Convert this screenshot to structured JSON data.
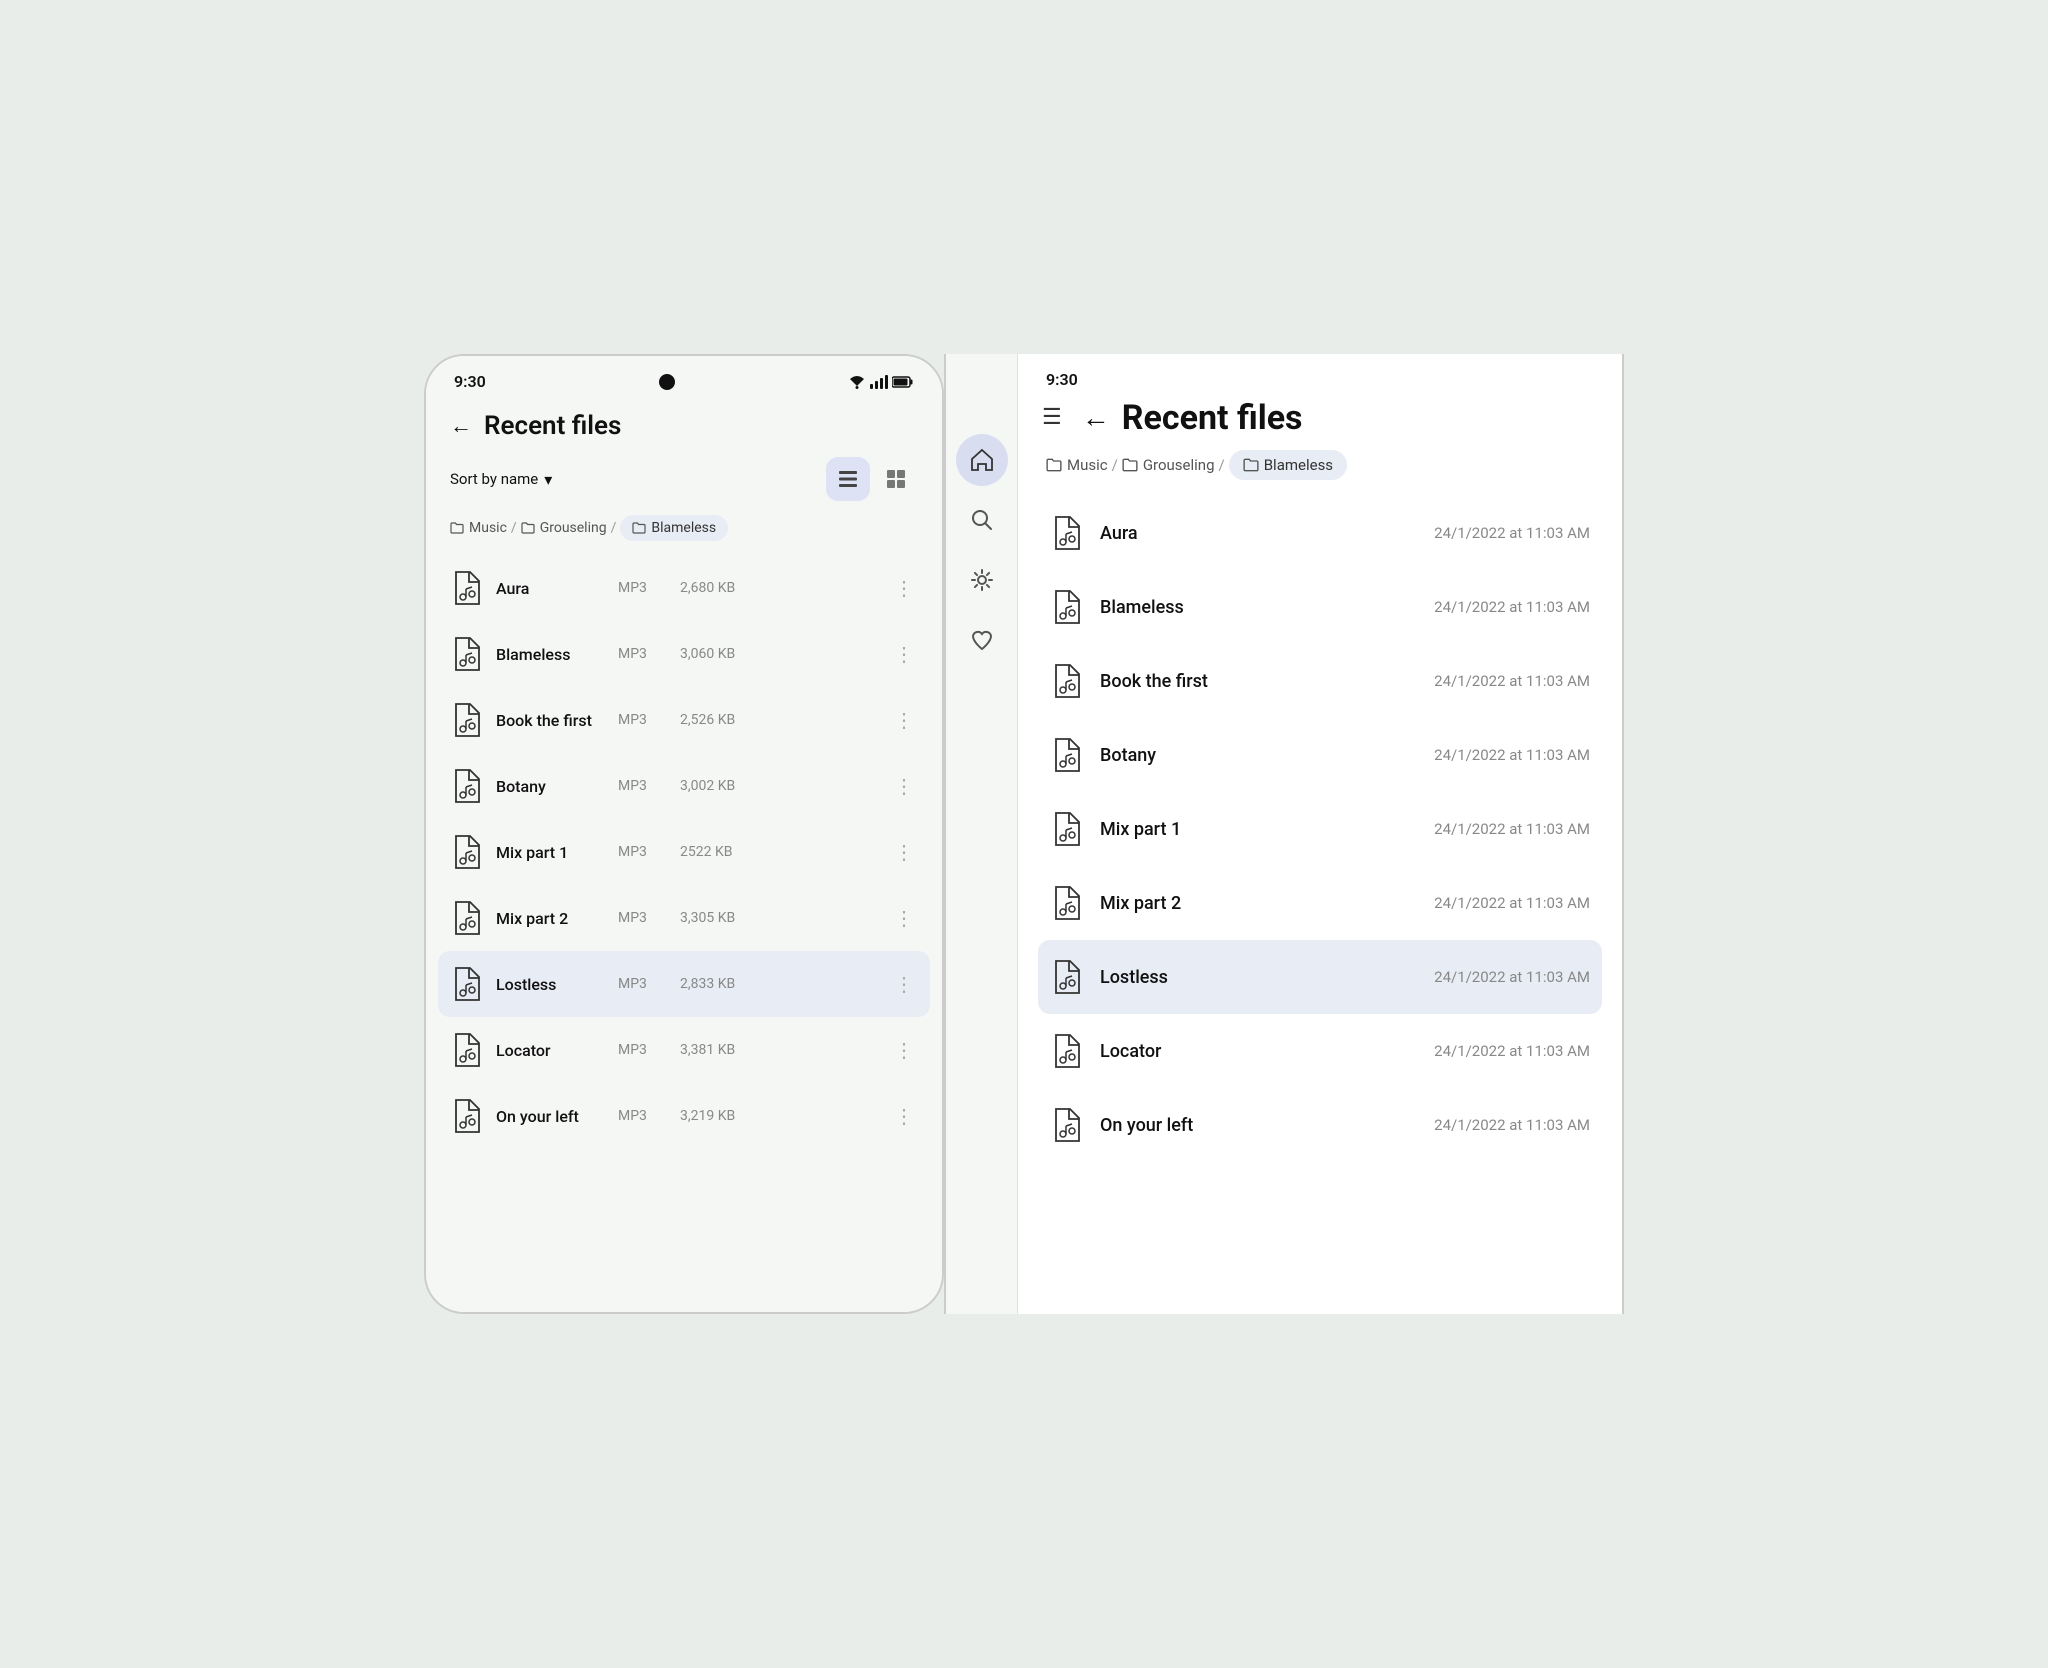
{
  "phone": {
    "status_bar": {
      "time": "9:30",
      "camera_label": "camera",
      "signal_label": "signal",
      "wifi_label": "wifi",
      "battery_label": "battery"
    },
    "header": {
      "back_label": "←",
      "title": "Recent files"
    },
    "toolbar": {
      "sort_label": "Sort by name",
      "sort_chevron": "▾",
      "list_view_label": "list view",
      "grid_view_label": "grid view"
    },
    "breadcrumbs": [
      {
        "label": "Music",
        "active": false
      },
      {
        "label": "Grouseling",
        "active": false
      },
      {
        "label": "Blameless",
        "active": true
      }
    ],
    "files": [
      {
        "name": "Aura",
        "type": "MP3",
        "size": "2,680 KB",
        "selected": false
      },
      {
        "name": "Blameless",
        "type": "MP3",
        "size": "3,060 KB",
        "selected": false
      },
      {
        "name": "Book the first",
        "type": "MP3",
        "size": "2,526 KB",
        "selected": false
      },
      {
        "name": "Botany",
        "type": "MP3",
        "size": "3,002 KB",
        "selected": false
      },
      {
        "name": "Mix part 1",
        "type": "MP3",
        "size": "2522 KB",
        "selected": false
      },
      {
        "name": "Mix part 2",
        "type": "MP3",
        "size": "3,305 KB",
        "selected": false
      },
      {
        "name": "Lostless",
        "type": "MP3",
        "size": "2,833 KB",
        "selected": true
      },
      {
        "name": "Locator",
        "type": "MP3",
        "size": "3,381 KB",
        "selected": false
      },
      {
        "name": "On your left",
        "type": "MP3",
        "size": "3,219 KB",
        "selected": false
      }
    ]
  },
  "tablet": {
    "status_bar": {
      "time": "9:30"
    },
    "nav": {
      "hamburger_label": "☰",
      "home_label": "home",
      "search_label": "search",
      "settings_label": "settings",
      "favorites_label": "favorites"
    },
    "header": {
      "back_label": "←",
      "title": "Recent files"
    },
    "breadcrumbs": [
      {
        "label": "Music",
        "active": false
      },
      {
        "label": "Grouseling",
        "active": false
      },
      {
        "label": "Blameless",
        "active": true
      }
    ],
    "files": [
      {
        "name": "Aura",
        "date": "24/1/2022 at 11:03 AM",
        "selected": false
      },
      {
        "name": "Blameless",
        "date": "24/1/2022 at 11:03 AM",
        "selected": false
      },
      {
        "name": "Book the first",
        "date": "24/1/2022 at 11:03 AM",
        "selected": false
      },
      {
        "name": "Botany",
        "date": "24/1/2022 at 11:03 AM",
        "selected": false
      },
      {
        "name": "Mix part 1",
        "date": "24/1/2022 at 11:03 AM",
        "selected": false
      },
      {
        "name": "Mix part 2",
        "date": "24/1/2022 at 11:03 AM",
        "selected": false
      },
      {
        "name": "Lostless",
        "date": "24/1/2022 at 11:03 AM",
        "selected": true
      },
      {
        "name": "Locator",
        "date": "24/1/2022 at 11:03 AM",
        "selected": false
      },
      {
        "name": "On your left",
        "date": "24/1/2022 at 11:03 AM",
        "selected": false
      }
    ]
  },
  "colors": {
    "selected_bg": "#e8ecf4",
    "active_breadcrumb_bg": "#e8ecf4",
    "list_view_active_bg": "#dde3f5",
    "nav_active_bg": "#d8def0",
    "background": "#e8ede9"
  }
}
